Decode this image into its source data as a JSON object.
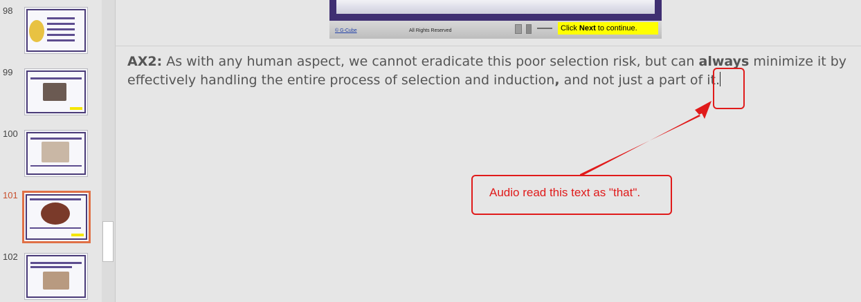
{
  "thumbnails": [
    {
      "number": "98",
      "active": false
    },
    {
      "number": "99",
      "active": false
    },
    {
      "number": "100",
      "active": false
    },
    {
      "number": "101",
      "active": true
    },
    {
      "number": "102",
      "active": false
    }
  ],
  "slide_preview": {
    "copyright": "© G-Cube",
    "rights": "All Rights Reserved",
    "banner_prefix": "Click ",
    "banner_bold": "Next",
    "banner_suffix": " to continue."
  },
  "notes": {
    "label": "AX2:",
    "part1": " As with any human aspect, we cannot eradicate this poor selection risk, but can ",
    "bold_word": "always",
    "part2": " minimize it by effectively handling the entire process of selection and induction",
    "comma": ",",
    "part3": " and not just a part of it."
  },
  "annotation": {
    "callout": "Audio read this text as \"that\".",
    "color": "#e01a1a"
  }
}
